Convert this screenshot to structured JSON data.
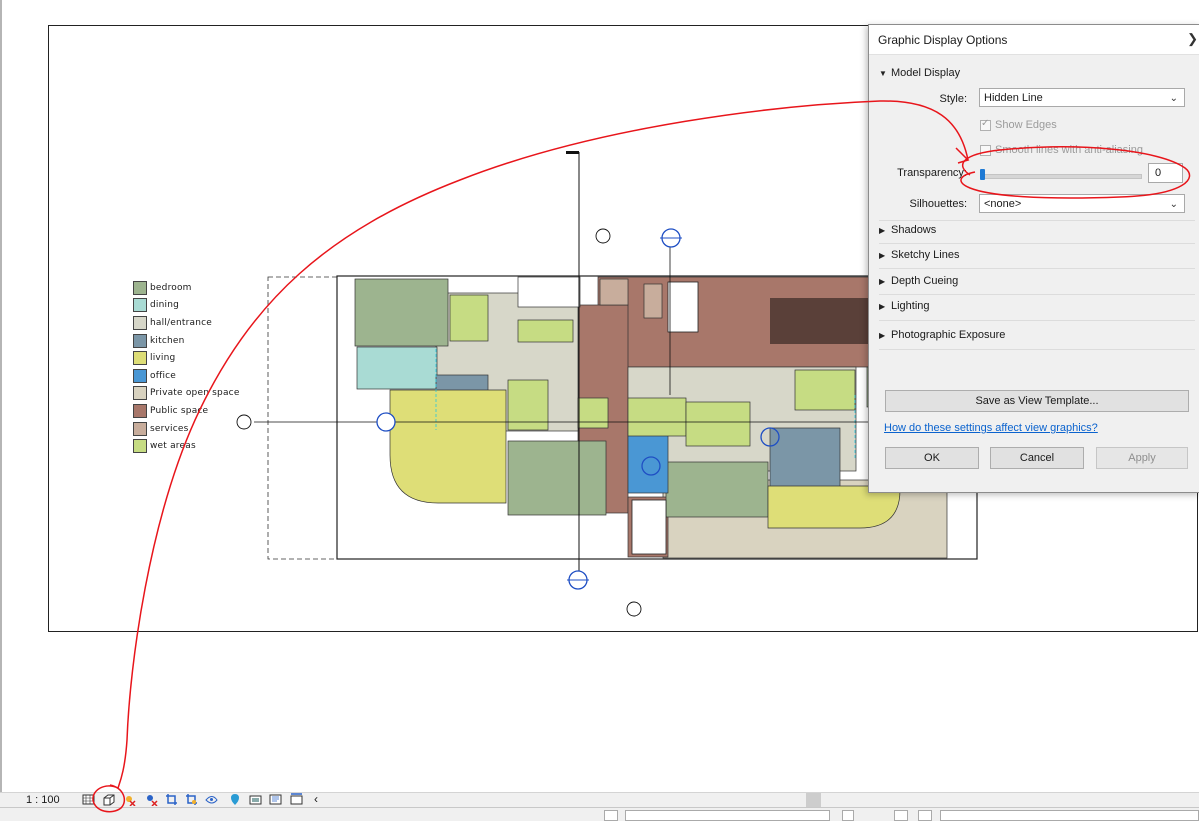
{
  "legend": [
    {
      "label": "bedroom",
      "color": "#9db48f"
    },
    {
      "label": "dining",
      "color": "#a9dbd4"
    },
    {
      "label": "hall/entrance",
      "color": "#d7d7c9"
    },
    {
      "label": "kitchen",
      "color": "#7b96a7"
    },
    {
      "label": "living",
      "color": "#dede77"
    },
    {
      "label": "office",
      "color": "#4a97d4"
    },
    {
      "label": "Private open space",
      "color": "#d9d3c0"
    },
    {
      "label": "Public space",
      "color": "#a8776a"
    },
    {
      "label": "services",
      "color": "#c8ad9c"
    },
    {
      "label": "wet areas",
      "color": "#c6dc83"
    }
  ],
  "dialog": {
    "title": "Graphic Display Options",
    "model_display": {
      "heading": "Model Display",
      "style_label": "Style:",
      "style_value": "Hidden Line",
      "show_edges": "Show Edges",
      "smooth_lines": "Smooth lines with anti-aliasing",
      "transparency_label": "Transparency:",
      "transparency_value": "0",
      "silhouettes_label": "Silhouettes:",
      "silhouettes_value": "<none>"
    },
    "sections": [
      "Shadows",
      "Sketchy Lines",
      "Depth Cueing",
      "Lighting",
      "Photographic Exposure"
    ],
    "save_template": "Save as View Template...",
    "help_link": "How do these settings affect view graphics?",
    "ok": "OK",
    "cancel": "Cancel",
    "apply": "Apply"
  },
  "statusbar": {
    "scale": "1 : 100"
  },
  "icons": [
    "detail-level-icon",
    "visual-style-icon",
    "sun-path-icon",
    "shadows-icon",
    "crop-view-icon",
    "show-crop-icon",
    "temporary-hide-icon",
    "reveal-hidden-icon",
    "worksharing-icon",
    "analytical-model-icon",
    "highlight-icon",
    "constraints-icon",
    "collapse-icon"
  ],
  "colors": {
    "annotation": "#e8151b",
    "accent": "#1e7ad4",
    "public_space": "#a8776a",
    "grid_marker": "#1f4fc4"
  }
}
